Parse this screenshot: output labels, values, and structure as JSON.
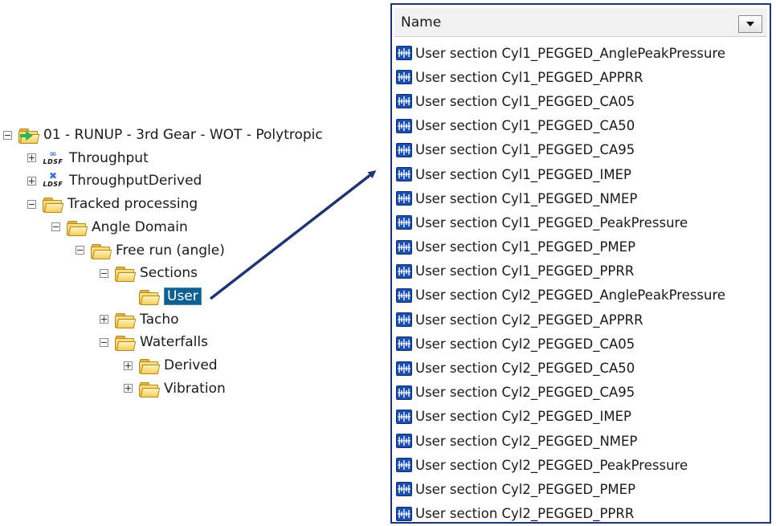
{
  "tree": {
    "nodes": [
      {
        "label": "01 - RUNUP - 3rd Gear - WOT - Polytropic",
        "toggle": "minus",
        "icon": "run-folder-icon",
        "level": 0
      },
      {
        "label": "Throughput",
        "toggle": "plus",
        "icon": "ldsf-link-icon",
        "level": 1
      },
      {
        "label": "ThroughputDerived",
        "toggle": "plus",
        "icon": "ldsf-x-icon",
        "level": 1
      },
      {
        "label": "Tracked processing",
        "toggle": "minus",
        "icon": "folder-icon",
        "level": 1
      },
      {
        "label": "Angle Domain",
        "toggle": "minus",
        "icon": "folder-icon",
        "level": 2
      },
      {
        "label": "Free run (angle)",
        "toggle": "minus",
        "icon": "folder-icon",
        "level": 3
      },
      {
        "label": "Sections",
        "toggle": "minus",
        "icon": "folder-icon",
        "level": 4
      },
      {
        "label": "User",
        "toggle": "none",
        "icon": "folder-icon",
        "level": 5,
        "selected": true
      },
      {
        "label": "Tacho",
        "toggle": "plus",
        "icon": "folder-icon",
        "level": 4
      },
      {
        "label": "Waterfalls",
        "toggle": "minus",
        "icon": "folder-icon",
        "level": 4
      },
      {
        "label": "Derived",
        "toggle": "plus",
        "icon": "folder-icon",
        "level": 5
      },
      {
        "label": "Vibration",
        "toggle": "plus",
        "icon": "folder-icon",
        "level": 5
      }
    ],
    "ldsf_text": "LDSF"
  },
  "list": {
    "header": "Name",
    "items": [
      "User section Cyl1_PEGGED_AnglePeakPressure",
      "User section Cyl1_PEGGED_APPRR",
      "User section Cyl1_PEGGED_CA05",
      "User section Cyl1_PEGGED_CA50",
      "User section Cyl1_PEGGED_CA95",
      "User section Cyl1_PEGGED_IMEP",
      "User section Cyl1_PEGGED_NMEP",
      "User section Cyl1_PEGGED_PeakPressure",
      "User section Cyl1_PEGGED_PMEP",
      "User section Cyl1_PEGGED_PPRR",
      "User section Cyl2_PEGGED_AnglePeakPressure",
      "User section Cyl2_PEGGED_APPRR",
      "User section Cyl2_PEGGED_CA05",
      "User section Cyl2_PEGGED_CA50",
      "User section Cyl2_PEGGED_CA95",
      "User section Cyl2_PEGGED_IMEP",
      "User section Cyl2_PEGGED_NMEP",
      "User section Cyl2_PEGGED_PeakPressure",
      "User section Cyl2_PEGGED_PMEP",
      "User section Cyl2_PEGGED_PPRR"
    ]
  },
  "colors": {
    "selection": "#0f5f8f",
    "arrow": "#1f3470",
    "panel_border": "#1f3470",
    "section_icon": "#1a4fae"
  }
}
